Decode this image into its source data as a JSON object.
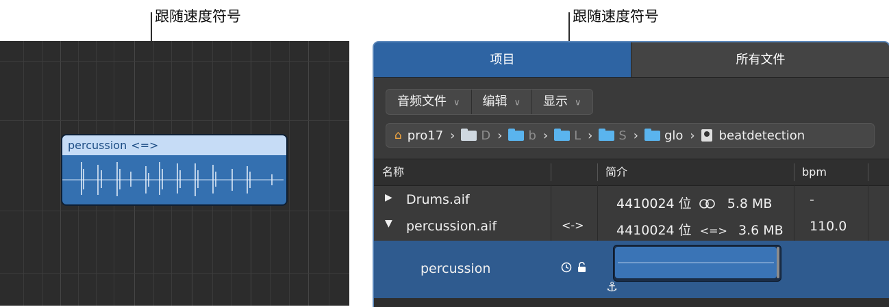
{
  "callouts": {
    "left": "跟随速度符号",
    "right": "跟随速度符号"
  },
  "region": {
    "name": "percussion",
    "tempo_symbol": "<=>"
  },
  "browser": {
    "tabs": [
      "项目",
      "所有文件"
    ],
    "menus": [
      "音频文件",
      "编辑",
      "显示"
    ],
    "path": [
      {
        "label": "pro17",
        "icon": "home-icon"
      },
      {
        "label": "D",
        "icon": "folder-icon"
      },
      {
        "label": "b",
        "icon": "folder-icon"
      },
      {
        "label": "L",
        "icon": "folder-icon"
      },
      {
        "label": "S",
        "icon": "folder-icon"
      },
      {
        "label": "glo",
        "icon": "folder-icon"
      },
      {
        "label": "beatdetection",
        "icon": "project-file-icon"
      }
    ],
    "columns": {
      "name": "名称",
      "info": "简介",
      "bpm": "bpm"
    },
    "rows": [
      {
        "name": "Drums.aif",
        "disclosure": "▶",
        "info": "4410024 位",
        "channel_icon": "stereo-icon",
        "size": "5.8 MB",
        "bpm": "-",
        "tempo_symbol": ""
      },
      {
        "name": "percussion.aif",
        "disclosure": "▼",
        "info": "4410024 位",
        "channel_symbol": "<=>",
        "size": "3.6 MB",
        "bpm": "110.0",
        "tempo_symbol": "<->"
      }
    ],
    "region_row": {
      "name": "percussion",
      "icons": [
        "clock-icon",
        "unlock-icon"
      ],
      "anchor_icon": "anchor-icon"
    }
  },
  "colors": {
    "accent": "#2e64a3",
    "region": "#3470b0",
    "region_header": "#c6dcf6"
  }
}
